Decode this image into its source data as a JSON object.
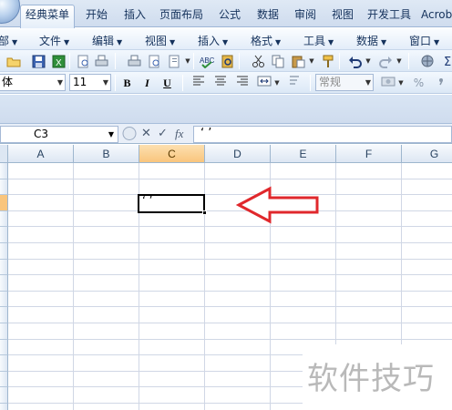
{
  "ribbon": {
    "tabs": [
      "经典菜单",
      "开始",
      "插入",
      "页面布局",
      "公式",
      "数据",
      "审阅",
      "视图",
      "开发工具",
      "Acrobat"
    ],
    "active_tab": "经典菜单"
  },
  "menu": {
    "items": [
      "部",
      "文件",
      "编辑",
      "视图",
      "插入",
      "格式",
      "工具",
      "数据",
      "窗口"
    ]
  },
  "toolbar_format": {
    "font_name": "体",
    "font_size": "11",
    "bold_label": "B",
    "italic_label": "I",
    "underline_label": "U",
    "number_format": "常规",
    "percent_label": "%"
  },
  "formula_bar": {
    "name_box": "C3",
    "cancel_symbol": "✕",
    "enter_symbol": "✓",
    "fx_label": "fx",
    "content": "‘ ’"
  },
  "grid": {
    "columns": [
      "A",
      "B",
      "C",
      "D",
      "E",
      "F",
      "G"
    ],
    "selected_column": "C",
    "selected_row_index": 3,
    "active_cell": {
      "ref": "C3",
      "value": "‘ ’"
    }
  },
  "colors": {
    "selected_header": "#f9c57d",
    "arrow": "#e0282c"
  },
  "icons": [
    "office-orb-icon",
    "open-icon",
    "save-icon",
    "excel-icon",
    "print-preview-icon",
    "print-icon",
    "spelling-icon",
    "cut-icon",
    "copy-icon",
    "paste-icon",
    "format-painter-icon",
    "undo-icon",
    "redo-icon",
    "align-left-icon",
    "align-center-icon",
    "align-right-icon",
    "merge-center-icon",
    "currency-icon"
  ],
  "watermark": "软件技巧"
}
